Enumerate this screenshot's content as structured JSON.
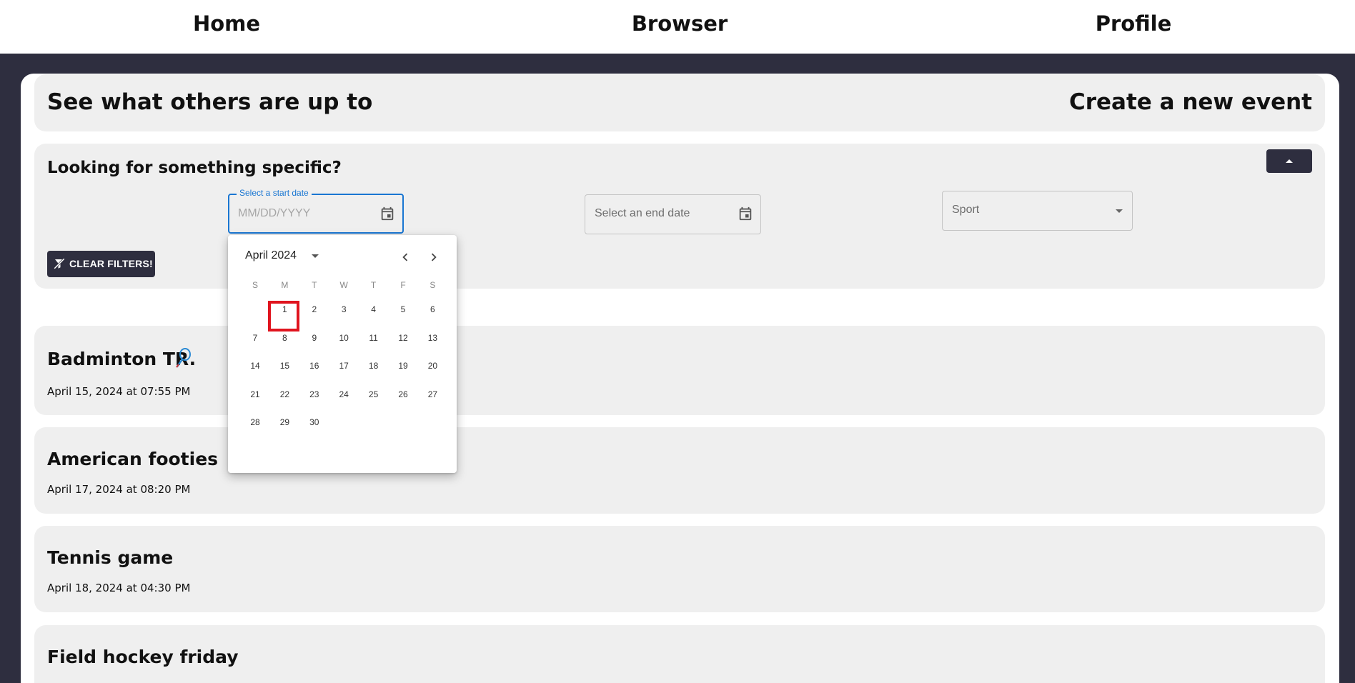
{
  "nav": {
    "home": "Home",
    "browser": "Browser",
    "profile": "Profile"
  },
  "header": {
    "left_title": "See what others are up to",
    "right_title": "Create a new event"
  },
  "filters": {
    "title": "Looking for something specific?",
    "start_date_label": "Select a start date",
    "start_date_placeholder": "MM/DD/YYYY",
    "end_date_placeholder": "Select an end date",
    "sport_placeholder": "Sport",
    "clear_label": "CLEAR FILTERS!"
  },
  "datepicker": {
    "month_label": "April 2024",
    "weekdays": [
      "S",
      "M",
      "T",
      "W",
      "T",
      "F",
      "S"
    ],
    "first_weekday": 1,
    "days_in_month": 30,
    "highlighted_day": 1
  },
  "events": [
    {
      "title": "Badminton TR.",
      "date": "April 15, 2024 at 07:55 PM",
      "icon": "badminton-racket-icon"
    },
    {
      "title": "American footies",
      "date": "April 17, 2024 at 08:20 PM"
    },
    {
      "title": "Tennis game",
      "date": "April 18, 2024 at 04:30 PM"
    },
    {
      "title": "Field hockey friday"
    }
  ],
  "colors": {
    "dark": "#2e2e3f",
    "panel": "#efefef",
    "accent_blue": "#1976d2",
    "highlight_red": "#e0141e"
  }
}
